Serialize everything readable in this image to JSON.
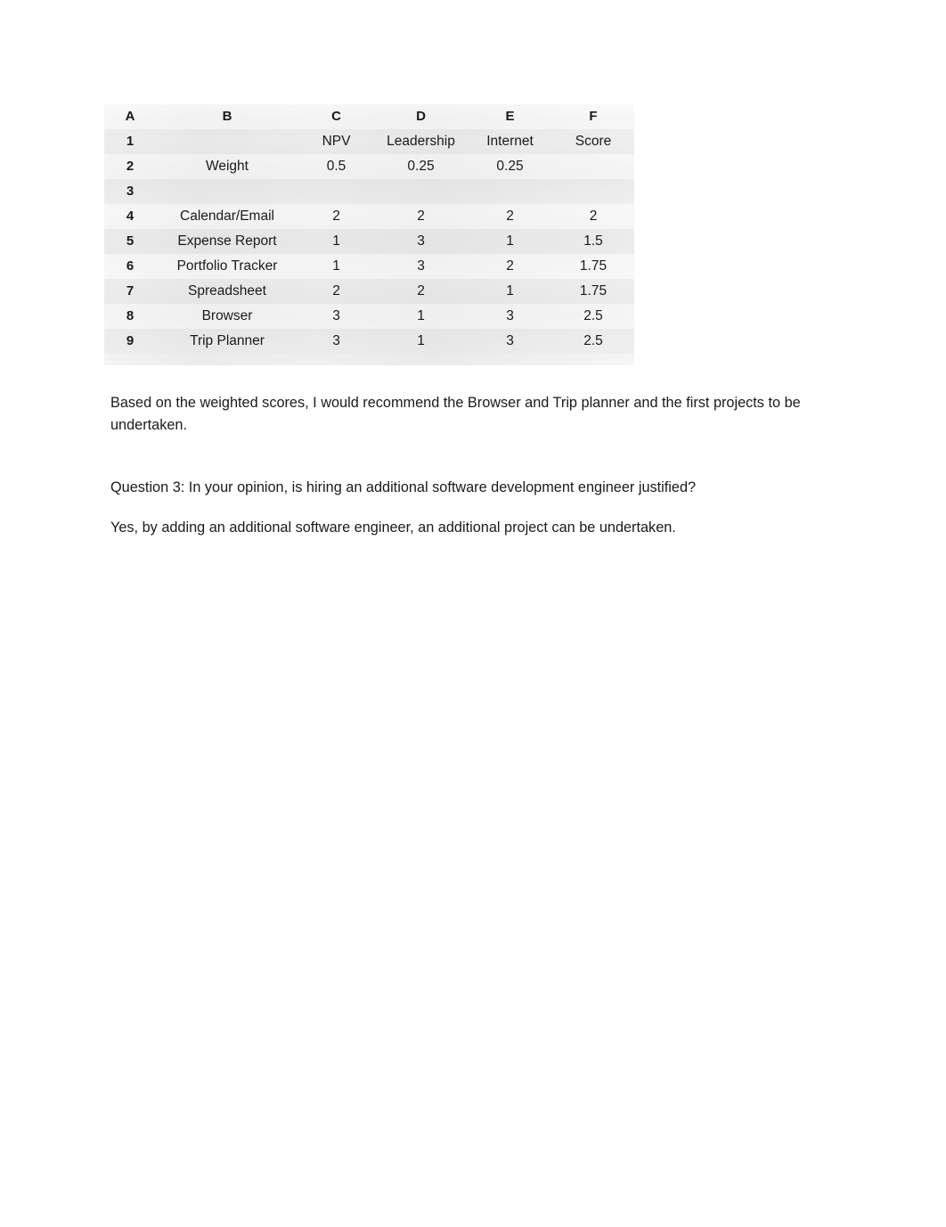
{
  "document": {
    "spreadsheet": {
      "column_headers": [
        "A",
        "B",
        "C",
        "D",
        "E",
        "F"
      ],
      "rows": [
        {
          "row_number": "1",
          "b": "",
          "c": "NPV",
          "d": "Leadership",
          "e": "Internet",
          "f": "Score"
        },
        {
          "row_number": "2",
          "b": "Weight",
          "c": "0.5",
          "d": "0.25",
          "e": "0.25",
          "f": ""
        },
        {
          "row_number": "3",
          "b": "",
          "c": "",
          "d": "",
          "e": "",
          "f": ""
        },
        {
          "row_number": "4",
          "b": "Calendar/Email",
          "c": "2",
          "d": "2",
          "e": "2",
          "f": "2"
        },
        {
          "row_number": "5",
          "b": "Expense Report",
          "c": "1",
          "d": "3",
          "e": "1",
          "f": "1.5"
        },
        {
          "row_number": "6",
          "b": "Portfolio Tracker",
          "c": "1",
          "d": "3",
          "e": "2",
          "f": "1.75"
        },
        {
          "row_number": "7",
          "b": "Spreadsheet",
          "c": "2",
          "d": "2",
          "e": "1",
          "f": "1.75"
        },
        {
          "row_number": "8",
          "b": "Browser",
          "c": "3",
          "d": "1",
          "e": "3",
          "f": "2.5"
        },
        {
          "row_number": "9",
          "b": "Trip Planner",
          "c": "3",
          "d": "1",
          "e": "3",
          "f": "2.5"
        }
      ]
    },
    "paragraphs": {
      "recommendation": "Based on the weighted scores, I would recommend the Browser and Trip planner and the first projects to be undertaken.",
      "question3": "Question 3: In your opinion, is hiring an additional software development engineer justified?",
      "answer3": "Yes, by adding an additional software engineer, an additional project can be undertaken."
    }
  }
}
